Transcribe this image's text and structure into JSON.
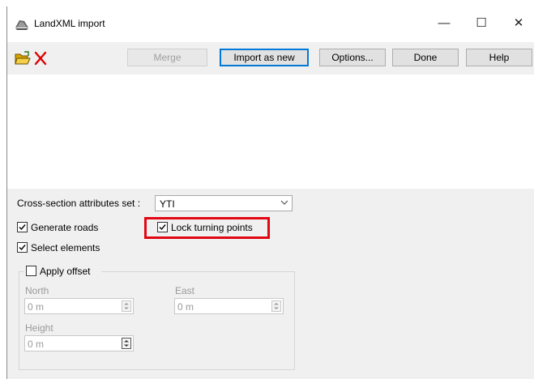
{
  "window": {
    "title": "LandXML import"
  },
  "titlebar": {
    "minimize_glyph": "—",
    "maximize_glyph": "☐",
    "close_glyph": "✕"
  },
  "toolbar": {
    "merge_label": "Merge",
    "import_new_label": "Import as new",
    "options_label": "Options...",
    "done_label": "Done",
    "help_label": "Help",
    "icons": [
      "open-folder-icon",
      "delete-x-icon"
    ]
  },
  "cross_section": {
    "label": "Cross-section attributes set :",
    "value": "YTI"
  },
  "checkboxes": {
    "generate_roads": {
      "label": "Generate roads",
      "checked": true
    },
    "lock_turning_points": {
      "label": "Lock turning points",
      "checked": true
    },
    "select_elements": {
      "label": "Select elements",
      "checked": true
    },
    "apply_offset": {
      "label": "Apply offset",
      "checked": false
    }
  },
  "offset": {
    "north_label": "North",
    "north_value": "0 m",
    "east_label": "East",
    "east_value": "0 m",
    "height_label": "Height",
    "height_value": "0 m"
  },
  "colors": {
    "highlight": "#e30613",
    "default_button_border": "#0078d7",
    "panel": "#f0f0f0"
  }
}
